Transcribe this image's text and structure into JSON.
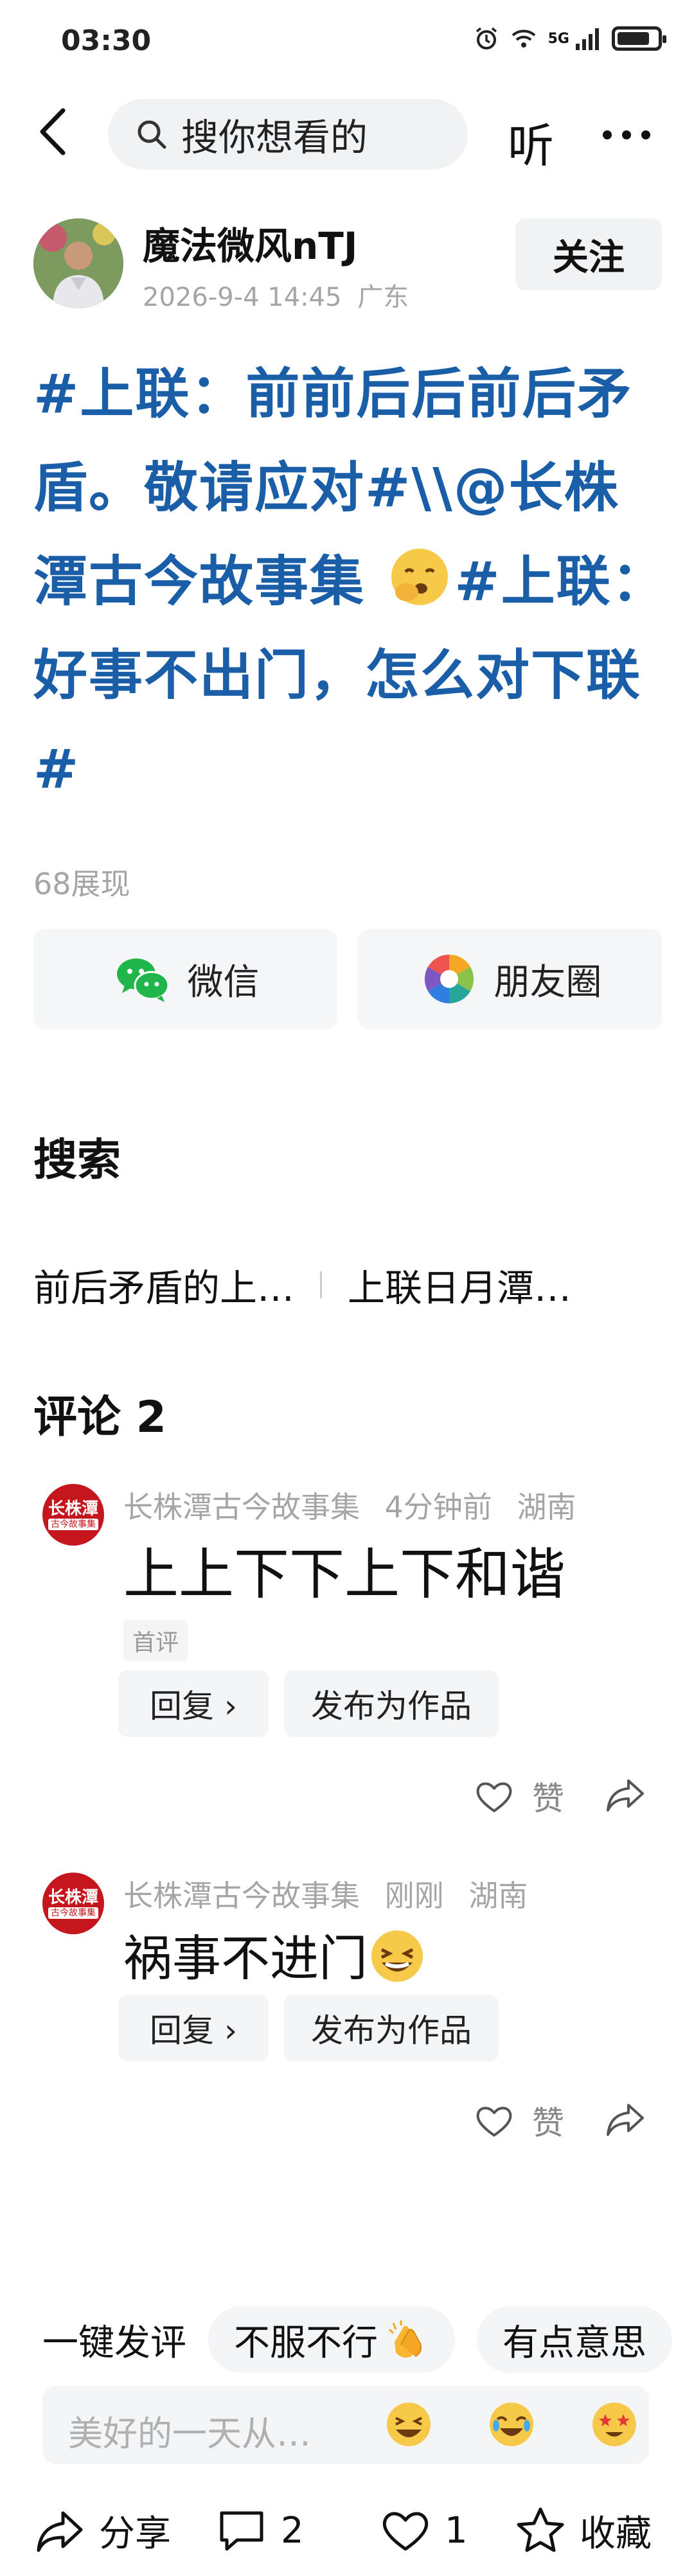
{
  "status_bar": {
    "time": "03:30",
    "network": "5G",
    "icons": [
      "alarm-icon",
      "wifi-icon",
      "signal-icon",
      "battery-icon"
    ]
  },
  "top_nav": {
    "search_placeholder": "搜你想看的",
    "listen_label": "听",
    "icons": [
      "back-arrow-icon",
      "search-icon",
      "more-icon"
    ]
  },
  "author": {
    "name": "魔法微风nTJ",
    "date": "2026-9-4 14:45",
    "location": "广东",
    "follow_label": "关注"
  },
  "post": {
    "part1": "#上联：前前后后前后矛盾。敬请应对#\\\\@长株潭古今故事集 ",
    "emoji": "yawning-face-emoji",
    "part2": "#上联：好事不出门，怎么对下联#",
    "views": "68展现"
  },
  "share": {
    "wechat_label": "微信",
    "moments_label": "朋友圈"
  },
  "search_section": {
    "title": "搜索",
    "suggestions": [
      "前后矛盾的上…",
      "上联日月潭…"
    ]
  },
  "comments_section": {
    "title": "评论 2",
    "comments": [
      {
        "avatar_text": "长株潭",
        "avatar_subtext": "古今故事集",
        "author": "长株潭古今故事集",
        "time": "4分钟前",
        "location": "湖南",
        "text": "上上下下上下和谐",
        "tag": "首评",
        "reply_label": "回复 ›",
        "publish_label": "发布为作品",
        "like_label": "赞"
      },
      {
        "avatar_text": "长株潭",
        "avatar_subtext": "古今故事集",
        "author": "长株潭古今故事集",
        "time": "刚刚",
        "location": "湖南",
        "text": "祸事不进门",
        "emoji": "grinning-squinting-face-emoji",
        "reply_label": "回复 ›",
        "publish_label": "发布为作品",
        "like_label": "赞"
      }
    ]
  },
  "quick_reply": {
    "label": "一键发评",
    "chips": [
      "不服不行",
      "有点意思"
    ],
    "chip_emoji": "clapping-hands-emoji"
  },
  "composer": {
    "placeholder": "美好的一天从…",
    "emojis": [
      "grinning-squinting-face-emoji",
      "rolling-laughing-face-emoji",
      "star-struck-face-emoji"
    ]
  },
  "bottom_bar": {
    "share_label": "分享",
    "comment_count": "2",
    "like_count": "1",
    "favorite_label": "收藏"
  }
}
